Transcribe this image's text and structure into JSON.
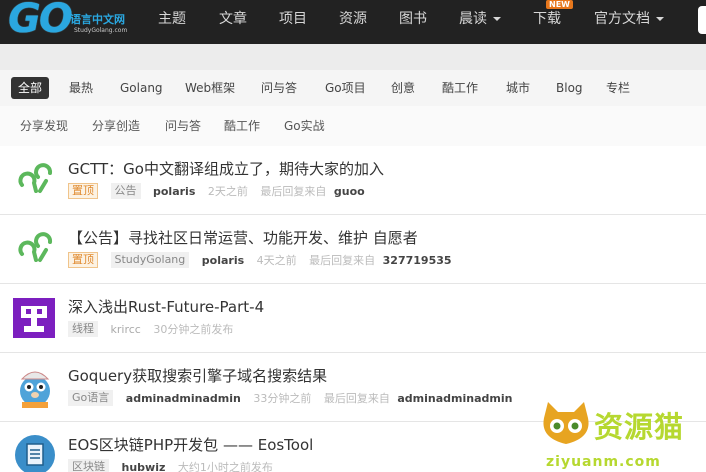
{
  "logo": {
    "mark": "GO",
    "name": "语言中文网",
    "site": "StudyGolang.com"
  },
  "nav": {
    "items": [
      "主题",
      "文章",
      "项目",
      "资源",
      "图书",
      "晨读",
      "下载",
      "官方文档"
    ],
    "new_badge": "NEW"
  },
  "categories": [
    "全部",
    "最热",
    "Golang",
    "Web框架",
    "问与答",
    "Go项目",
    "创意",
    "酷工作",
    "城市",
    "Blog",
    "专栏"
  ],
  "subcategories": [
    "分享发现",
    "分享创造",
    "问与答",
    "酷工作",
    "Go实战"
  ],
  "topics": [
    {
      "title": "GCTT：Go中文翻译组成立了，期待大家的加入",
      "pin": "置顶",
      "tag": "公告",
      "user": "polaris",
      "time": "2天之前",
      "last_label": "最后回复来自",
      "last_user": "guoo"
    },
    {
      "title": "【公告】寻找社区日常运营、功能开发、维护 自愿者",
      "pin": "置顶",
      "tag": "StudyGolang",
      "user": "polaris",
      "time": "4天之前",
      "last_label": "最后回复来自",
      "last_user": "327719535"
    },
    {
      "title": "深入浅出Rust-Future-Part-4",
      "tag": "线程",
      "user": "krircc",
      "time": "30分钟之前发布"
    },
    {
      "title": "Goquery获取搜索引擎子域名搜索结果",
      "tag": "Go语言",
      "user": "adminadminadmin",
      "time": "33分钟之前",
      "last_label": "最后回复来自",
      "last_user": "adminadminadmin"
    },
    {
      "title": "EOS区块链PHP开发包 —— EosTool",
      "tag": "区块链",
      "user": "hubwiz",
      "time": "大约1小时之前发布"
    }
  ],
  "watermark": {
    "text": "资源猫",
    "url": "ziyuanm.com"
  },
  "colors": {
    "navbar": "#222222",
    "logo": "#2aa7e0",
    "pin": "#e08a2e",
    "watermark": "#b6d830"
  }
}
